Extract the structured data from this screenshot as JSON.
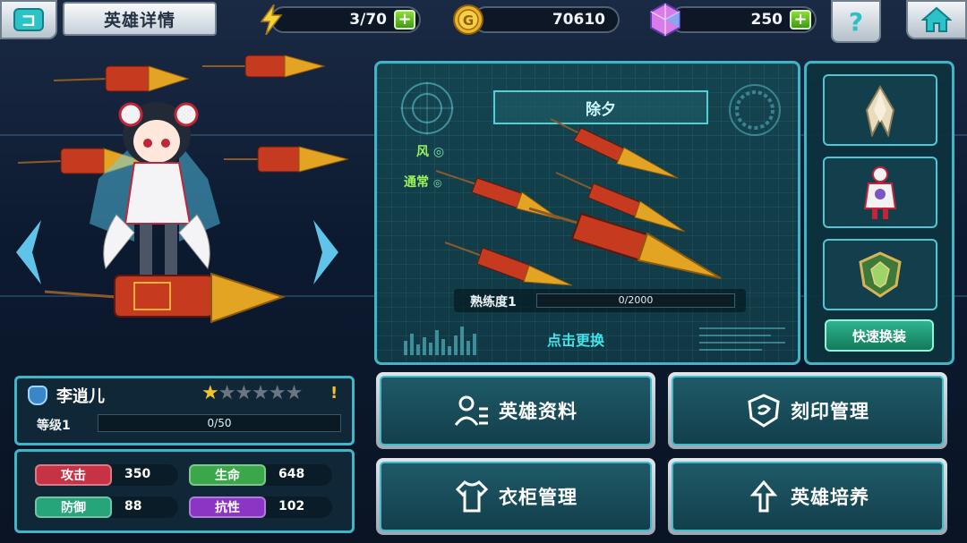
{
  "header": {
    "back_icon": "back-arrow-icon",
    "title": "英雄详情",
    "stamina": "3/70",
    "gold": "70610",
    "gems": "250",
    "help_glyph": "?"
  },
  "weapon": {
    "name": "除夕",
    "element": "风",
    "rarity": "通常",
    "proficiency_label": "熟练度1",
    "proficiency_value": "0/2000",
    "proficiency_fraction": 0,
    "change_label": "点击更换"
  },
  "side": {
    "quick_equip": "快速换装"
  },
  "hero": {
    "name": "李逍儿",
    "stars_filled": 1,
    "stars_total": 6,
    "warn": "!",
    "level_label": "等级1",
    "exp_value": "0/50",
    "exp_fraction": 0
  },
  "stats": {
    "attack_label": "攻击",
    "attack": "350",
    "hp_label": "生命",
    "hp": "648",
    "defense_label": "防御",
    "defense": "88",
    "resist_label": "抗性",
    "resist": "102"
  },
  "menu": {
    "hero_info": "英雄资料",
    "seal_manage": "刻印管理",
    "wardrobe": "衣柜管理",
    "hero_train": "英雄培养"
  },
  "colors": {
    "accent": "#3fb6c6",
    "attack": "#c73345",
    "hp": "#3aa84a",
    "defense": "#25a579",
    "resist": "#8a35c4",
    "star": "#f0c42b"
  }
}
